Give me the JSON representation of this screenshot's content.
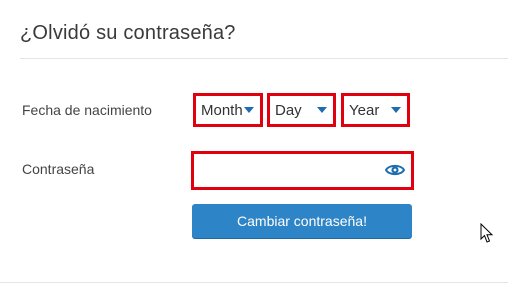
{
  "page": {
    "title": "¿Olvidó su contraseña?"
  },
  "form": {
    "dob_label": "Fecha de nacimiento",
    "month": {
      "value": "Month",
      "icon": "caret-down-icon"
    },
    "day": {
      "value": "Day",
      "icon": "caret-down-icon"
    },
    "year": {
      "value": "Year",
      "icon": "caret-down-icon"
    },
    "password_label": "Contraseña",
    "password": {
      "value": "",
      "placeholder": "",
      "icon": "eye-icon"
    },
    "submit_label": "Cambiar contraseña!"
  },
  "colors": {
    "highlight": "#e0000e",
    "button": "#2d84c6",
    "accent": "#1e6db0"
  }
}
